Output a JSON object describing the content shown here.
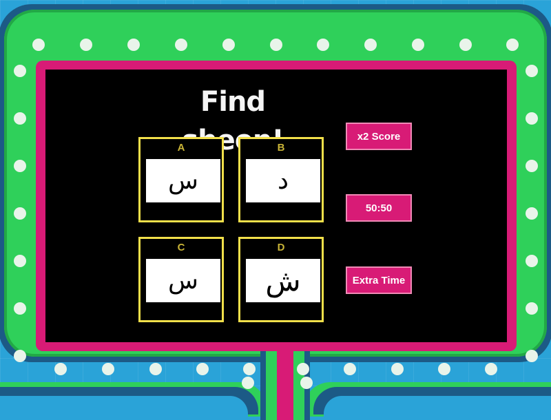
{
  "question": {
    "text": "Find sheen!"
  },
  "answers": [
    {
      "letter": "A",
      "glyph": "س"
    },
    {
      "letter": "B",
      "glyph": "د"
    },
    {
      "letter": "C",
      "glyph": "س"
    },
    {
      "letter": "D",
      "glyph": "ش"
    }
  ],
  "powerups": [
    {
      "label": "x2 Score"
    },
    {
      "label": "50:50"
    },
    {
      "label": "Extra Time"
    }
  ],
  "colors": {
    "background": "#2aa3d8",
    "frame_green": "#2fd05a",
    "frame_dark": "#1c5a86",
    "frame_pink": "#d81b76",
    "answer_border": "#f2e04a",
    "letter_color": "#c9b437",
    "screen": "#000000"
  }
}
